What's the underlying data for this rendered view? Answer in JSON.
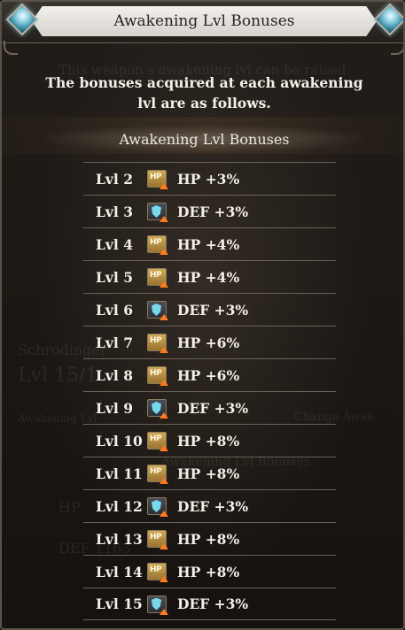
{
  "dialog": {
    "title": "Awakening Lvl Bonuses",
    "intro": "The bonuses acquired at each awakening lvl are as follows.",
    "section_header": "Awakening Lvl Bonuses"
  },
  "background_hints": {
    "line1": "This weapon's awakening lvl can be raised",
    "line2": "Schrodinger",
    "line3": "Lvl 15/1",
    "line4": "Awakening Lvl",
    "line5": "Change Awak",
    "line6": "Awakening Lvl Bonuses",
    "line7": "HP",
    "line8": "DEF 1163"
  },
  "bonuses": [
    {
      "level": "Lvl 2",
      "icon": "hp-up-icon",
      "text": "HP +3%"
    },
    {
      "level": "Lvl 3",
      "icon": "def-up-icon",
      "text": "DEF +3%"
    },
    {
      "level": "Lvl 4",
      "icon": "hp-up-icon",
      "text": "HP +4%"
    },
    {
      "level": "Lvl 5",
      "icon": "hp-up-icon",
      "text": "HP +4%"
    },
    {
      "level": "Lvl 6",
      "icon": "def-up-icon",
      "text": "DEF +3%"
    },
    {
      "level": "Lvl 7",
      "icon": "hp-up-icon",
      "text": "HP +6%"
    },
    {
      "level": "Lvl 8",
      "icon": "hp-up-icon",
      "text": "HP +6%"
    },
    {
      "level": "Lvl 9",
      "icon": "def-up-icon",
      "text": "DEF +3%"
    },
    {
      "level": "Lvl 10",
      "icon": "hp-up-icon",
      "text": "HP +8%"
    },
    {
      "level": "Lvl 11",
      "icon": "hp-up-icon",
      "text": "HP +8%"
    },
    {
      "level": "Lvl 12",
      "icon": "def-up-icon",
      "text": "DEF +3%"
    },
    {
      "level": "Lvl 13",
      "icon": "hp-up-icon",
      "text": "HP +8%"
    },
    {
      "level": "Lvl 14",
      "icon": "hp-up-icon",
      "text": "HP +8%"
    },
    {
      "level": "Lvl 15",
      "icon": "def-up-icon",
      "text": "DEF +3%"
    }
  ],
  "icon_labels": {
    "hp": "HP"
  },
  "colors": {
    "accent_gem": "#8fd2e2",
    "hp_icon": "#cfa956",
    "def_icon": "#78d8ec",
    "up_arrow": "#ff7a1c"
  }
}
